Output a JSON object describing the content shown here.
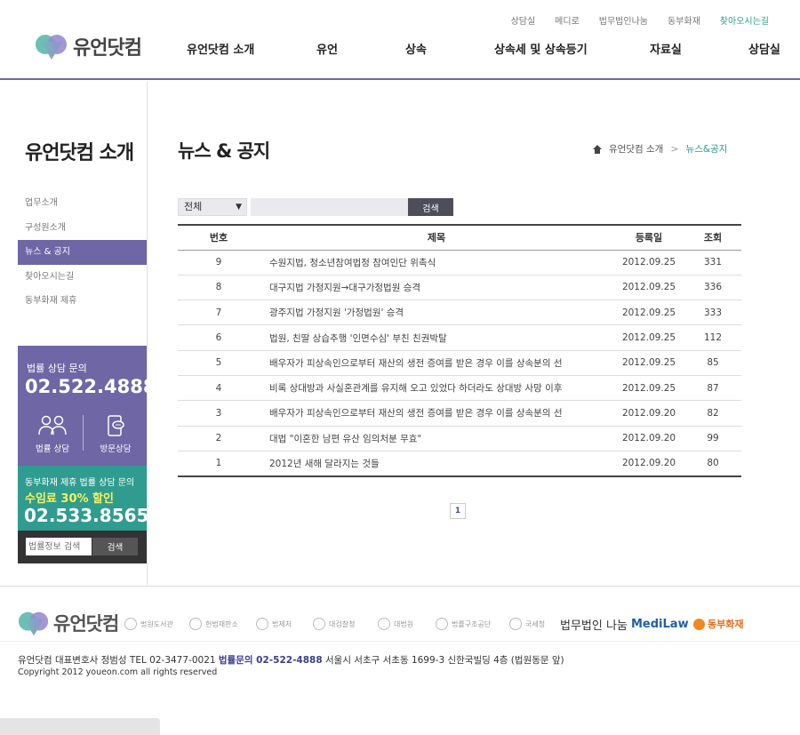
{
  "header": {
    "logo_text": "유언닷컴",
    "util_links": [
      "상담실",
      "메디로",
      "법무법인나눔",
      "동부화재",
      "찾아오시는길"
    ],
    "nav": [
      "유언닷컴 소개",
      "유언",
      "상속",
      "상속세 및 상속등기",
      "자료실",
      "상담실"
    ]
  },
  "sidebar": {
    "title": "유언닷컴 소개",
    "items": [
      {
        "label": "업무소개"
      },
      {
        "label": "구성원소개"
      },
      {
        "label": "뉴스 & 공지"
      },
      {
        "label": "찾아오시는길"
      },
      {
        "label": "동부화재 제휴"
      }
    ],
    "consult": {
      "title": "법률 상담 문의",
      "phone": "02.522.4888",
      "btn_legal": "법률 상담",
      "btn_visit": "방문상담"
    },
    "dongbu": {
      "title": "동부화재 제휴 법률 상담 문의",
      "promo": "수임료 30% 할인",
      "phone": "02.533.8565"
    },
    "search": {
      "placeholder": "법률정보 검색",
      "button": "검색"
    }
  },
  "content": {
    "title": "뉴스 & 공지",
    "breadcrumb": {
      "parent": "유언닷컴 소개",
      "sep": ">",
      "current": "뉴스&공지"
    },
    "filter": {
      "selected": "전체",
      "button": "검색"
    },
    "table": {
      "headers": {
        "no": "번호",
        "title": "제목",
        "date": "등록일",
        "views": "조회"
      },
      "rows": [
        {
          "no": "9",
          "title": "수원지법, 청소년참여법정 참여인단 위촉식",
          "date": "2012.09.25",
          "views": "331"
        },
        {
          "no": "8",
          "title": "대구지법 가정지원→대구가정법원 승격",
          "date": "2012.09.25",
          "views": "336"
        },
        {
          "no": "7",
          "title": "광주지법 가정지원 '가정법원' 승격",
          "date": "2012.09.25",
          "views": "333"
        },
        {
          "no": "6",
          "title": "법원, 친딸 상습추행 '인면수심' 부친 친권박탈",
          "date": "2012.09.25",
          "views": "112"
        },
        {
          "no": "5",
          "title": "배우자가 피상속인으로부터 재산의 생전 증여를 받은 경우 이를 상속분의 선",
          "date": "2012.09.25",
          "views": "85"
        },
        {
          "no": "4",
          "title": "비록 상대방과 사실혼관계를 유지해 오고 있었다 하더라도 상대방 사망 이후",
          "date": "2012.09.25",
          "views": "87"
        },
        {
          "no": "3",
          "title": "배우자가 피상속인으로부터 재산의 생전 증여를 받은 경우 이를 상속분의 선",
          "date": "2012.09.20",
          "views": "82"
        },
        {
          "no": "2",
          "title": "대법 \"이혼한 남편 유산 임의처분 무효\"",
          "date": "2012.09.20",
          "views": "99"
        },
        {
          "no": "1",
          "title": "2012년 새해 달라지는 것들",
          "date": "2012.09.20",
          "views": "80"
        }
      ]
    },
    "pager": [
      "1"
    ]
  },
  "footer": {
    "logo_text": "유언닷컴",
    "partners": [
      "법원도서관",
      "헌법재판소",
      "법제처",
      "대검찰청",
      "대법원",
      "법률구조공단",
      "국세청",
      "법무법인 나눔",
      "MediLaw",
      "동부화재"
    ],
    "info_prefix": "유언닷컴 대표변호사 정범성 TEL 02-3477-0021 ",
    "info_phone": "법률문의 02-522-4888",
    "info_suffix": " 서울시 서초구 서초동 1699-3 신한국빌딩 4층 (법원동문 앞)",
    "copyright": "Copyright 2012 youeon.com all rights reserved"
  }
}
